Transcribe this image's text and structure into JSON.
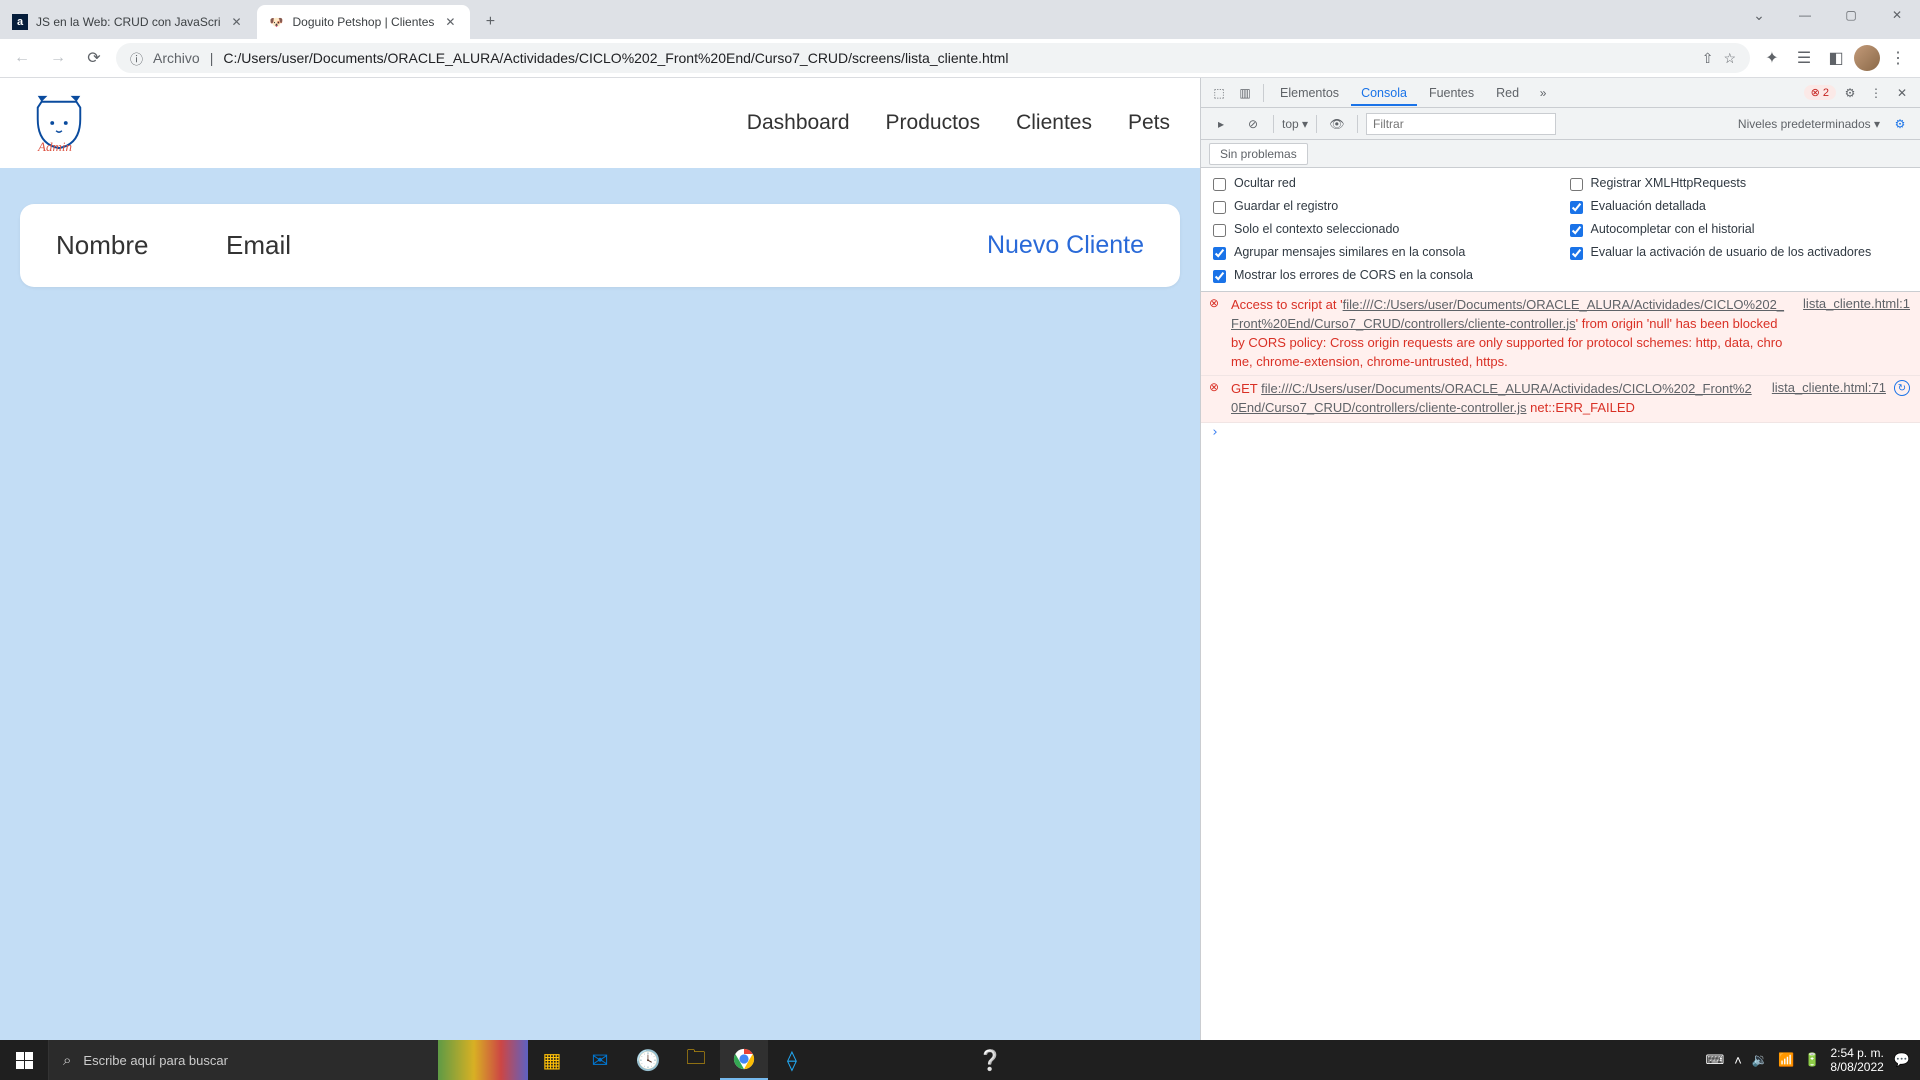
{
  "chrome": {
    "tabs": [
      {
        "title": "JS en la Web: CRUD con JavaScri",
        "active": false
      },
      {
        "title": "Doguito Petshop | Clientes",
        "active": true
      }
    ],
    "url_scheme_label": "Archivo",
    "url_path": "C:/Users/user/Documents/ORACLE_ALURA/Actividades/CICLO%202_Front%20End/Curso7_CRUD/screens/lista_cliente.html"
  },
  "page": {
    "logo_sub": "Admin",
    "nav": [
      "Dashboard",
      "Productos",
      "Clientes",
      "Pets"
    ],
    "table_headers": {
      "name": "Nombre",
      "email": "Email"
    },
    "new_client": "Nuevo Cliente"
  },
  "devtools": {
    "tabs": [
      "Elementos",
      "Consola",
      "Fuentes",
      "Red"
    ],
    "active_tab": "Consola",
    "error_count": "2",
    "context": "top ▾",
    "filter_placeholder": "Filtrar",
    "levels": "Niveles predeterminados ▾",
    "no_issues": "Sin problemas",
    "checks": {
      "ocultar_red": "Ocultar red",
      "registrar_xhr": "Registrar XMLHttpRequests",
      "guardar_registro": "Guardar el registro",
      "eval_detallada": "Evaluación detallada",
      "solo_contexto": "Solo el contexto seleccionado",
      "autocompletar": "Autocompletar con el historial",
      "agrupar": "Agrupar mensajes similares en la consola",
      "evaluar_activacion": "Evaluar la activación de usuario de los activadores",
      "mostrar_cors": "Mostrar los errores de CORS en la consola"
    },
    "msg1": {
      "pre": "Access to script at '",
      "link": "file:///C:/Users/user/Documents/ORACLE_ALURA/Actividades/CICLO%202_Front%20End/Curso7_CRUD/controllers/cliente-controller.js",
      "post": "' from origin 'null' has been blocked by CORS policy: Cross origin requests are only supported for protocol schemes: http, data, chrome, chrome-extension, chrome-untrusted, https.",
      "src": "lista_cliente.html:1"
    },
    "msg2": {
      "method": "GET ",
      "link": "file:///C:/Users/user/Documents/ORACLE_ALURA/Actividades/CICLO%202_Front%20End/Curso7_CRUD/controllers/cliente-controller.js",
      "err": " net::ERR_FAILED",
      "src": "lista_cliente.html:71"
    }
  },
  "taskbar": {
    "search_placeholder": "Escribe aquí para buscar",
    "time": "2:54 p. m.",
    "date": "8/08/2022"
  }
}
